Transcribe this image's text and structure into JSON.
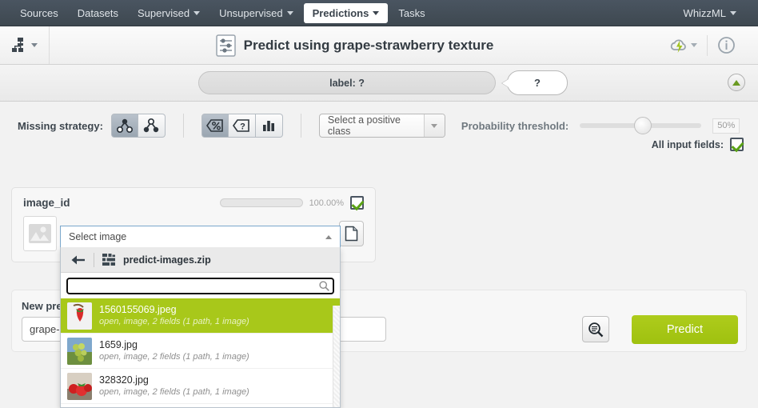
{
  "topnav": {
    "items": [
      {
        "label": "Sources",
        "caret": false,
        "active": false
      },
      {
        "label": "Datasets",
        "caret": false,
        "active": false
      },
      {
        "label": "Supervised",
        "caret": true,
        "active": false
      },
      {
        "label": "Unsupervised",
        "caret": true,
        "active": false
      },
      {
        "label": "Predictions",
        "caret": true,
        "active": true
      },
      {
        "label": "Tasks",
        "caret": false,
        "active": false
      }
    ],
    "right_item": {
      "label": "WhizzML",
      "caret": true
    }
  },
  "titlebar": {
    "title": "Predict using grape-strawberry texture",
    "model_icon": "model-tree-icon",
    "source_icon": "prediction-sliders-icon",
    "cloud_icon": "cloud-lightning-icon",
    "info_icon": "info-circle-icon"
  },
  "prediction_bar": {
    "objective_label": "label: ?",
    "bubble_label": "?",
    "collapse_icon": "collapse-up-icon"
  },
  "toolbar": {
    "missing_strategy_label": "Missing strategy:",
    "missing_strategy_buttons": [
      {
        "name": "missing-strategy-proportional-icon",
        "active": true
      },
      {
        "name": "missing-strategy-last-prediction-icon",
        "active": false
      }
    ],
    "view_buttons": [
      {
        "name": "percentage-view-icon",
        "active": true
      },
      {
        "name": "confidence-view-icon",
        "active": false
      },
      {
        "name": "histogram-view-icon",
        "active": false
      }
    ],
    "positive_class_value": "Select a positive class",
    "probability_threshold_label": "Probability threshold:",
    "threshold_value": "50%",
    "all_input_fields_label": "All input fields:",
    "all_input_fields_checked": true
  },
  "field_card": {
    "field_name": "image_id",
    "progress_pct": "100.00%",
    "progress_value": 100,
    "checked": true,
    "image_placeholder_icon": "image-placeholder-icon",
    "file_button_icon": "file-document-icon"
  },
  "image_dropdown": {
    "trigger_value": "Select image",
    "trigger_caret": "chevron-up-icon",
    "back_icon": "back-arrow-icon",
    "source_icon": "composite-source-icon",
    "source_name": "predict-images.zip",
    "search_value": "",
    "search_placeholder": "",
    "search_icon": "search-icon",
    "items": [
      {
        "title": "1560155069.jpeg",
        "subtitle": "open, image, 2 fields (1 path, 1 image)",
        "selected": true,
        "thumb": "strawberry-hand-thumb"
      },
      {
        "title": "1659.jpg",
        "subtitle": "open, image, 2 fields (1 path, 1 image)",
        "selected": false,
        "thumb": "green-grapes-thumb"
      },
      {
        "title": "328320.jpg",
        "subtitle": "open, image, 2 fields (1 path, 1 image)",
        "selected": false,
        "thumb": "strawberries-thumb"
      }
    ]
  },
  "new_prediction": {
    "label": "New prediction",
    "name_value": "grape-strawberry texture",
    "search_icon": "zoom-search-icon",
    "predict_button": "Predict"
  },
  "colors": {
    "accent_green": "#a8c81a",
    "nav_dark": "#3e4850",
    "progress_green": "#9fc31a"
  }
}
